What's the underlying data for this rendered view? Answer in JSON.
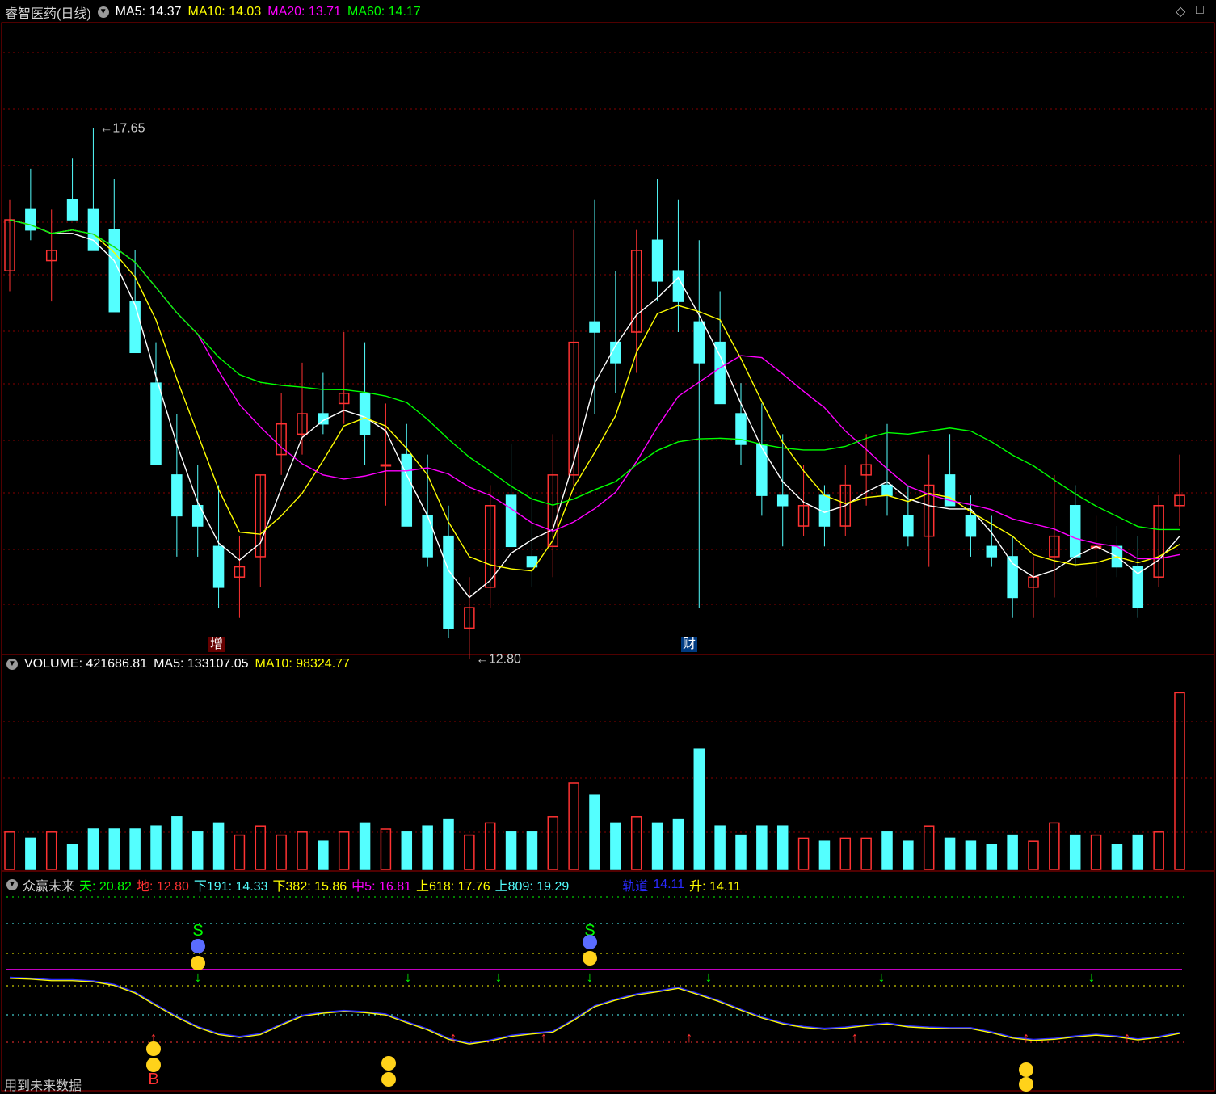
{
  "main": {
    "name": "睿智医药(日线)",
    "ma5": "MA5: 14.37",
    "ma10": "MA10: 14.03",
    "ma20": "MA20: 13.71",
    "ma60": "MA60: 14.17",
    "high": "17.65",
    "low": "12.80",
    "tag_zeng": "增",
    "tag_cai": "财"
  },
  "volume": {
    "vol": "VOLUME: 421686.81",
    "ma5": "MA5: 133107.05",
    "ma10": "MA10: 98324.77"
  },
  "indicator": {
    "name": "众赢未来",
    "tian": "天: 20.82",
    "di": "地: 12.80",
    "x191": "下191: 14.33",
    "x382": "下382: 15.86",
    "z5": "中5: 16.81",
    "s618": "上618: 17.76",
    "s809": "上809: 19.29",
    "guidao_label": "轨道",
    "guidao_val": "14.11",
    "sheng": "升: 14.11",
    "s_mark": "S",
    "b_mark": "B"
  },
  "footer": "用到未来数据",
  "colors": {
    "up": "#ff3232",
    "down": "#54ffff",
    "ma5": "#ffffff",
    "ma10": "#ffff00",
    "ma20": "#ff00ff",
    "ma60": "#00ff00",
    "grid": "#a00000",
    "blue": "#2a2aff"
  },
  "chart_data": {
    "type": "candlestick",
    "ohlc": [
      [
        16.2,
        16.9,
        16.0,
        16.7
      ],
      [
        16.8,
        17.2,
        16.5,
        16.6
      ],
      [
        16.3,
        16.8,
        15.9,
        16.4
      ],
      [
        16.9,
        17.3,
        16.8,
        16.7
      ],
      [
        16.8,
        17.6,
        16.6,
        16.4
      ],
      [
        16.6,
        17.1,
        16.1,
        15.8
      ],
      [
        15.9,
        16.4,
        15.4,
        15.4
      ],
      [
        15.1,
        15.5,
        14.4,
        14.3
      ],
      [
        14.2,
        14.8,
        13.4,
        13.8
      ],
      [
        13.9,
        14.3,
        13.4,
        13.7
      ],
      [
        13.5,
        14.1,
        12.9,
        13.1
      ],
      [
        13.2,
        13.6,
        12.8,
        13.3
      ],
      [
        13.4,
        14.2,
        13.1,
        14.2
      ],
      [
        14.4,
        15.0,
        14.2,
        14.7
      ],
      [
        14.6,
        15.3,
        14.4,
        14.8
      ],
      [
        14.8,
        15.2,
        14.6,
        14.7
      ],
      [
        14.9,
        15.6,
        14.7,
        15.0
      ],
      [
        15.0,
        15.5,
        14.3,
        14.6
      ],
      [
        14.3,
        14.9,
        13.9,
        14.3
      ],
      [
        14.4,
        14.7,
        13.8,
        13.7
      ],
      [
        13.8,
        14.4,
        13.3,
        13.4
      ],
      [
        13.6,
        13.9,
        12.6,
        12.7
      ],
      [
        12.7,
        13.2,
        12.4,
        12.9
      ],
      [
        13.1,
        14.1,
        12.9,
        13.9
      ],
      [
        14.0,
        14.5,
        13.6,
        13.5
      ],
      [
        13.4,
        14.0,
        13.1,
        13.3
      ],
      [
        13.5,
        14.6,
        13.2,
        14.2
      ],
      [
        14.2,
        16.6,
        14.1,
        15.5
      ],
      [
        15.7,
        16.9,
        14.8,
        15.6
      ],
      [
        15.5,
        16.2,
        15.0,
        15.3
      ],
      [
        15.6,
        16.6,
        15.2,
        16.4
      ],
      [
        16.5,
        17.1,
        15.9,
        16.1
      ],
      [
        16.2,
        16.9,
        15.6,
        15.9
      ],
      [
        15.7,
        16.5,
        12.9,
        15.3
      ],
      [
        15.5,
        16.0,
        14.9,
        14.9
      ],
      [
        14.8,
        15.1,
        14.3,
        14.5
      ],
      [
        14.5,
        14.9,
        13.8,
        14.0
      ],
      [
        14.0,
        14.6,
        13.5,
        13.9
      ],
      [
        13.7,
        14.3,
        13.6,
        13.9
      ],
      [
        14.0,
        14.1,
        13.5,
        13.7
      ],
      [
        13.7,
        14.3,
        13.6,
        14.1
      ],
      [
        14.2,
        14.6,
        13.9,
        14.3
      ],
      [
        14.1,
        14.7,
        13.8,
        14.0
      ],
      [
        13.8,
        14.1,
        13.5,
        13.6
      ],
      [
        13.6,
        14.4,
        13.3,
        14.1
      ],
      [
        14.2,
        14.6,
        13.9,
        13.9
      ],
      [
        13.8,
        14.0,
        13.4,
        13.6
      ],
      [
        13.5,
        13.8,
        13.3,
        13.4
      ],
      [
        13.4,
        13.6,
        12.8,
        13.0
      ],
      [
        13.1,
        13.4,
        12.8,
        13.2
      ],
      [
        13.4,
        14.2,
        13.0,
        13.6
      ],
      [
        13.9,
        14.1,
        13.3,
        13.4
      ],
      [
        13.5,
        13.8,
        13.0,
        13.5
      ],
      [
        13.5,
        13.7,
        13.2,
        13.3
      ],
      [
        13.3,
        13.6,
        12.8,
        12.9
      ],
      [
        13.2,
        14.0,
        13.1,
        13.9
      ],
      [
        13.9,
        14.4,
        13.7,
        14.0
      ]
    ],
    "vol_ma5": 133107.05,
    "vol_ma10": 98324.77,
    "high_marker": 17.65,
    "low_marker": 12.8
  }
}
